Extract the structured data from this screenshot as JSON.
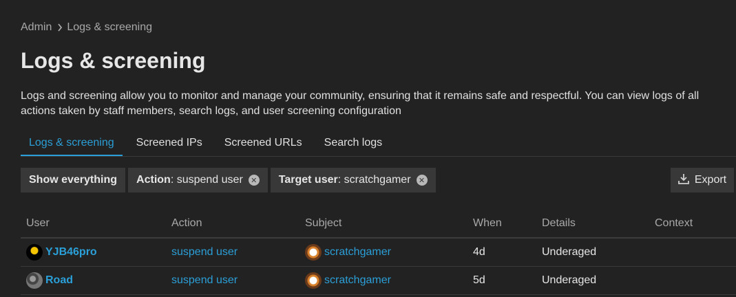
{
  "breadcrumb": {
    "root": "Admin",
    "current": "Logs & screening"
  },
  "page": {
    "title": "Logs & screening",
    "description": "Logs and screening allow you to monitor and manage your community, ensuring that it remains safe and respectful. You can view logs of all actions taken by staff members, search logs, and user screening configuration"
  },
  "tabs": [
    {
      "label": "Logs & screening",
      "active": true
    },
    {
      "label": "Screened IPs"
    },
    {
      "label": "Screened URLs"
    },
    {
      "label": "Search logs"
    }
  ],
  "filters": {
    "show_everything": "Show everything",
    "action": {
      "key": "Action",
      "value": ": suspend user"
    },
    "target_user": {
      "key": "Target user",
      "value": ": scratchgamer"
    }
  },
  "export_label": "Export",
  "table": {
    "headers": [
      "User",
      "Action",
      "Subject",
      "When",
      "Details",
      "Context"
    ],
    "rows": [
      {
        "user": "YJB46pro",
        "action": "suspend user",
        "subject": "scratchgamer",
        "when": "4d",
        "details": "Underaged",
        "context": ""
      },
      {
        "user": "Road",
        "action": "suspend user",
        "subject": "scratchgamer",
        "when": "5d",
        "details": "Underaged",
        "context": ""
      }
    ]
  },
  "colors": {
    "background": "#222222",
    "accent": "#2b9fd7",
    "chip": "#383838"
  }
}
